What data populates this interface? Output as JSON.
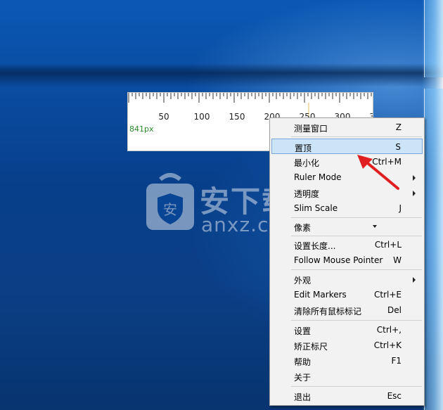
{
  "ruler": {
    "ticks": [
      "50",
      "100",
      "150",
      "200",
      "250",
      "300",
      "3"
    ],
    "readout": "841px"
  },
  "watermark": {
    "title": "安下载",
    "sub": "anxz.com",
    "shield_char": "安"
  },
  "menu": {
    "items": [
      {
        "label": "测量窗口",
        "shortcut": "Z"
      },
      {
        "label": "置顶",
        "shortcut": "S"
      },
      {
        "label": "最小化",
        "shortcut": "Ctrl+M"
      },
      {
        "label": "Ruler Mode",
        "shortcut": ""
      },
      {
        "label": "透明度",
        "shortcut": ""
      },
      {
        "label": "Slim Scale",
        "shortcut": "J"
      },
      {
        "label": "像素",
        "shortcut": ""
      },
      {
        "label": "设置长度...",
        "shortcut": "Ctrl+L"
      },
      {
        "label": "Follow Mouse Pointer",
        "shortcut": "W"
      },
      {
        "label": "外观",
        "shortcut": ""
      },
      {
        "label": "Edit Markers",
        "shortcut": "Ctrl+E"
      },
      {
        "label": "清除所有鼠标标记",
        "shortcut": "Del"
      },
      {
        "label": "设置",
        "shortcut": "Ctrl+,"
      },
      {
        "label": "矫正标尺",
        "shortcut": "Ctrl+K"
      },
      {
        "label": "帮助",
        "shortcut": "F1"
      },
      {
        "label": "关于",
        "shortcut": ""
      },
      {
        "label": "退出",
        "shortcut": "Esc"
      }
    ],
    "highlighted_index": 1
  },
  "colors": {
    "highlight_bg": "#cce4f7",
    "arrow": "#e02020",
    "readout": "#2a8a2a"
  }
}
